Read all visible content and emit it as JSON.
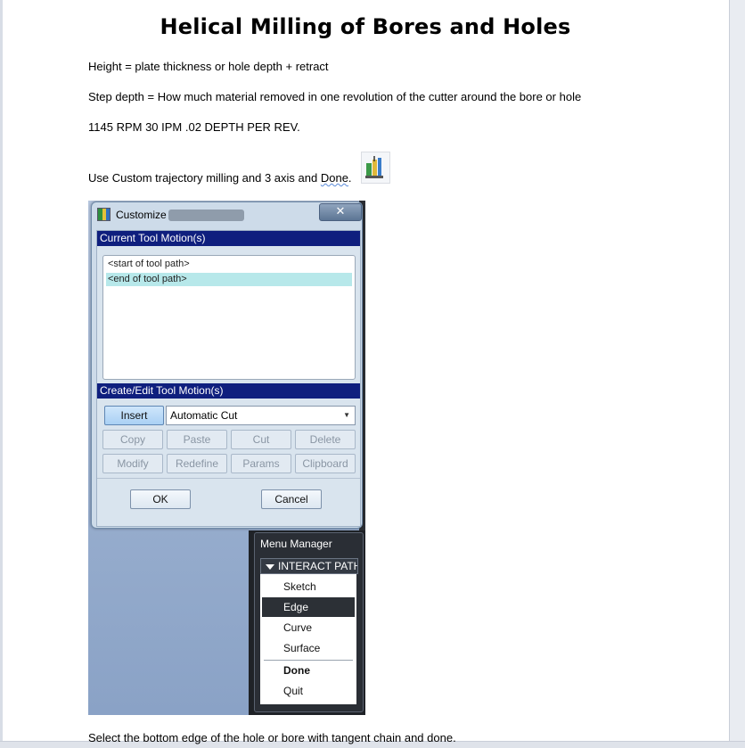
{
  "document": {
    "title": "Helical Milling of Bores and Holes",
    "paragraphs": {
      "height": "Height = plate thickness or hole depth + retract",
      "step_depth": "Step depth = How much material removed in one revolution of the cutter around the bore or hole",
      "feeds": "1145  RPM 30  IPM .02 DEPTH PER REV.",
      "use_custom": "Use Custom trajectory milling and 3 axis and ",
      "use_custom_done": "Done",
      "use_custom_end": ".",
      "select_edge": "Select the bottom edge of the hole or bore with tangent chain and done."
    }
  },
  "customize_dialog": {
    "title": "Customize",
    "close_glyph": "✕",
    "current_motions_header": "Current Tool Motion(s)",
    "motions": [
      "<start of tool path>",
      "<end of tool path>"
    ],
    "create_edit_header": "Create/Edit Tool Motion(s)",
    "insert_label": "Insert",
    "motion_type_value": "Automatic Cut",
    "buttons_row1": [
      "Copy",
      "Paste",
      "Cut",
      "Delete"
    ],
    "buttons_row2": [
      "Modify",
      "Redefine",
      "Params",
      "Clipboard"
    ],
    "ok_label": "OK",
    "cancel_label": "Cancel"
  },
  "menu_manager": {
    "title": "Menu Manager",
    "header": "INTERACT PATH",
    "items": [
      "Sketch",
      "Edge",
      "Curve",
      "Surface",
      "Done",
      "Quit"
    ],
    "selected_item": "Edge"
  }
}
